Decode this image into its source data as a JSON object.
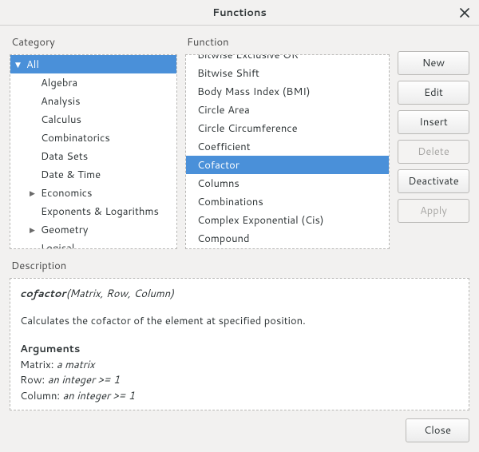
{
  "window": {
    "title": "Functions",
    "panels": {
      "category_label": "Category",
      "function_label": "Function",
      "description_label": "Description"
    }
  },
  "buttons": {
    "new": "New",
    "edit": "Edit",
    "insert": "Insert",
    "delete": "Delete",
    "deactivate": "Deactivate",
    "apply": "Apply",
    "close": "Close"
  },
  "categories": {
    "root": {
      "label": "All",
      "expanded": true,
      "selected": true
    },
    "items": [
      {
        "label": "Algebra",
        "expander": ""
      },
      {
        "label": "Analysis",
        "expander": ""
      },
      {
        "label": "Calculus",
        "expander": ""
      },
      {
        "label": "Combinatorics",
        "expander": ""
      },
      {
        "label": "Data Sets",
        "expander": ""
      },
      {
        "label": "Date & Time",
        "expander": ""
      },
      {
        "label": "Economics",
        "expander": "▶"
      },
      {
        "label": "Exponents & Logarithms",
        "expander": ""
      },
      {
        "label": "Geometry",
        "expander": "▶"
      },
      {
        "label": "Logical",
        "expander": ""
      }
    ]
  },
  "functions": [
    {
      "label": "Bitwise Exclusive OR",
      "cut": true,
      "selected": false
    },
    {
      "label": "Bitwise Shift",
      "selected": false
    },
    {
      "label": "Body Mass Index (BMI)",
      "selected": false
    },
    {
      "label": "Circle Area",
      "selected": false
    },
    {
      "label": "Circle Circumference",
      "selected": false
    },
    {
      "label": "Coefficient",
      "selected": false
    },
    {
      "label": "Cofactor",
      "selected": true
    },
    {
      "label": "Columns",
      "selected": false
    },
    {
      "label": "Combinations",
      "selected": false
    },
    {
      "label": "Complex Exponential (Cis)",
      "selected": false
    },
    {
      "label": "Compound",
      "selected": false
    }
  ],
  "description": {
    "signature_name": "cofactor",
    "signature_args": "(Matrix, Row, Column)",
    "body": "Calculates the cofactor of the element at specified position.",
    "arguments_head": "Arguments",
    "arguments": [
      {
        "name": "Matrix:",
        "val": "a matrix"
      },
      {
        "name": "Row:",
        "val": "an integer >= 1"
      },
      {
        "name": "Column:",
        "val": "an integer >= 1"
      }
    ]
  }
}
